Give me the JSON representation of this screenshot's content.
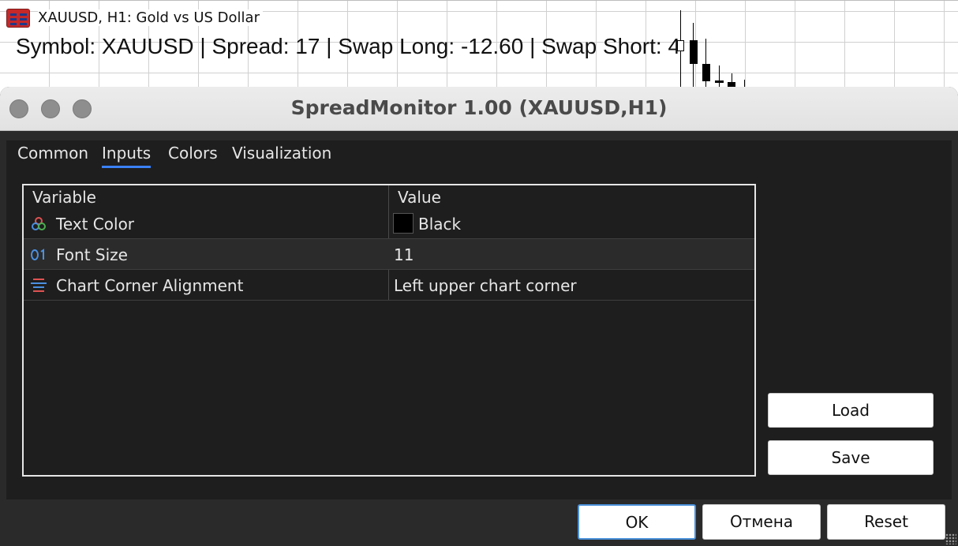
{
  "chart": {
    "window_title": "XAUUSD, H1:  Gold vs US Dollar",
    "info_line": "Symbol: XAUUSD | Spread: 17 | Swap Long: -12.60 | Swap Short: 4",
    "icon": "chart-window-icon"
  },
  "dialog": {
    "title": "SpreadMonitor 1.00 (XAUUSD,H1)",
    "tabs": [
      {
        "label": "Common",
        "active": false
      },
      {
        "label": "Inputs",
        "active": true
      },
      {
        "label": "Colors",
        "active": false
      },
      {
        "label": "Visualization",
        "active": false
      }
    ],
    "table": {
      "headers": {
        "variable": "Variable",
        "value": "Value"
      },
      "rows": [
        {
          "icon": "color-palette-icon",
          "variable": "Text Color",
          "value": "Black",
          "swatch": "#000000"
        },
        {
          "icon": "integer-icon",
          "variable": "Font Size",
          "value": "11"
        },
        {
          "icon": "enum-list-icon",
          "variable": "Chart Corner Alignment",
          "value": "Left upper chart corner"
        }
      ]
    },
    "buttons": {
      "load": "Load",
      "save": "Save",
      "ok": "OK",
      "cancel": "Отмена",
      "reset": "Reset"
    }
  },
  "colors": {
    "accent": "#3b82f6",
    "dialog_bg": "#2a2a2a",
    "panel_bg": "#1e1e1e"
  }
}
